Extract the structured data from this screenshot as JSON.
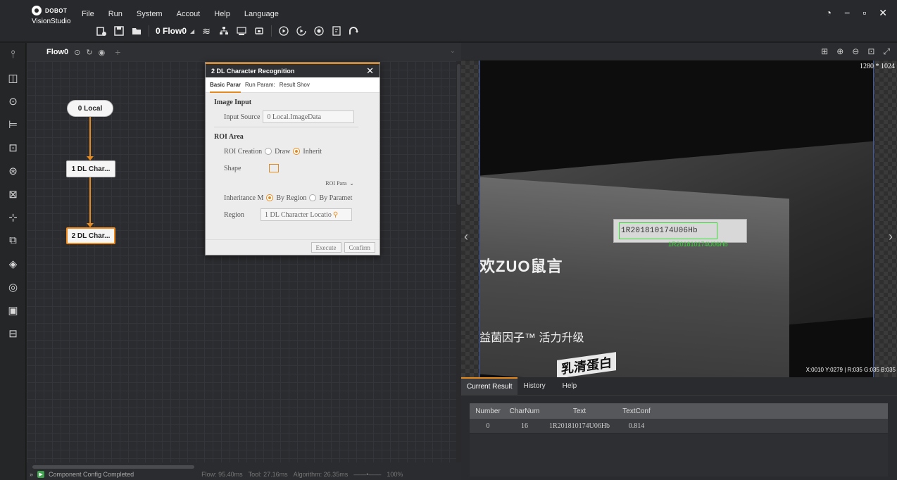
{
  "titlebar": {
    "brand": "DOBOT",
    "app_name": "VisionStudio",
    "menu": [
      "File",
      "Run",
      "System",
      "Accout",
      "Help",
      "Language"
    ],
    "flow_select": "0 Flow0"
  },
  "flow": {
    "tab_label": "Flow0",
    "nodes": {
      "local": "0 Local",
      "node1": "1 DL Char...",
      "node2": "2 DL Char..."
    }
  },
  "dialog": {
    "title": "2 DL Character Recognition",
    "tabs": [
      "Basic Parar",
      "Run Param:",
      "Result Shov"
    ],
    "image_input": {
      "section": "Image Input",
      "label": "Input Source",
      "value": "0 Local.ImageData"
    },
    "roi": {
      "section": "ROI Area",
      "creation_label": "ROI Creation",
      "draw": "Draw",
      "inherit": "Inherit",
      "shape_label": "Shape",
      "roi_param": "ROI Para",
      "inheritance_label": "Inheritance M",
      "by_region": "By Region",
      "by_param": "By Paramet",
      "region_label": "Region",
      "region_value": "1 DL Character Locatio"
    },
    "buttons": {
      "execute": "Execute",
      "confirm": "Confirm"
    }
  },
  "image": {
    "resolution": "1280 * 1024",
    "label_text": "1R201810174U06Hb",
    "overlay_text": "1R201810174U06Hb",
    "brand_line1": "欢ZUO鼠言",
    "brand_line2": "益菌因子™ 活力升级",
    "brand_line3": "乳清蛋白",
    "coords": "X:0010 Y:0279 | R:035 G:035 B:035"
  },
  "results": {
    "tabs": [
      "Current Result",
      "History",
      "Help"
    ],
    "columns": [
      "Number",
      "CharNum",
      "Text",
      "TextConf"
    ],
    "rows": [
      {
        "number": "0",
        "charnum": "16",
        "text": "1R201810174U06Hb",
        "textconf": "0.814"
      }
    ]
  },
  "status": {
    "message": "Component Config Completed",
    "flow": "Flow: 95.40ms",
    "tool": "Tool: 27.16ms",
    "algorithm": "Algorithm: 26.35ms",
    "zoom": "100%"
  },
  "colors": {
    "accent": "#e58a1f",
    "roi_green": "#3ad63a",
    "status_green": "#3fa34d"
  },
  "icons": {
    "left_tools": [
      "image-source-icon",
      "camera-icon",
      "locate-icon",
      "measure-icon",
      "recognize-icon",
      "calibrate-icon",
      "compare-icon",
      "align-icon",
      "image-process-icon",
      "color-icon",
      "defect-icon",
      "logic-icon",
      "communication-icon"
    ]
  }
}
